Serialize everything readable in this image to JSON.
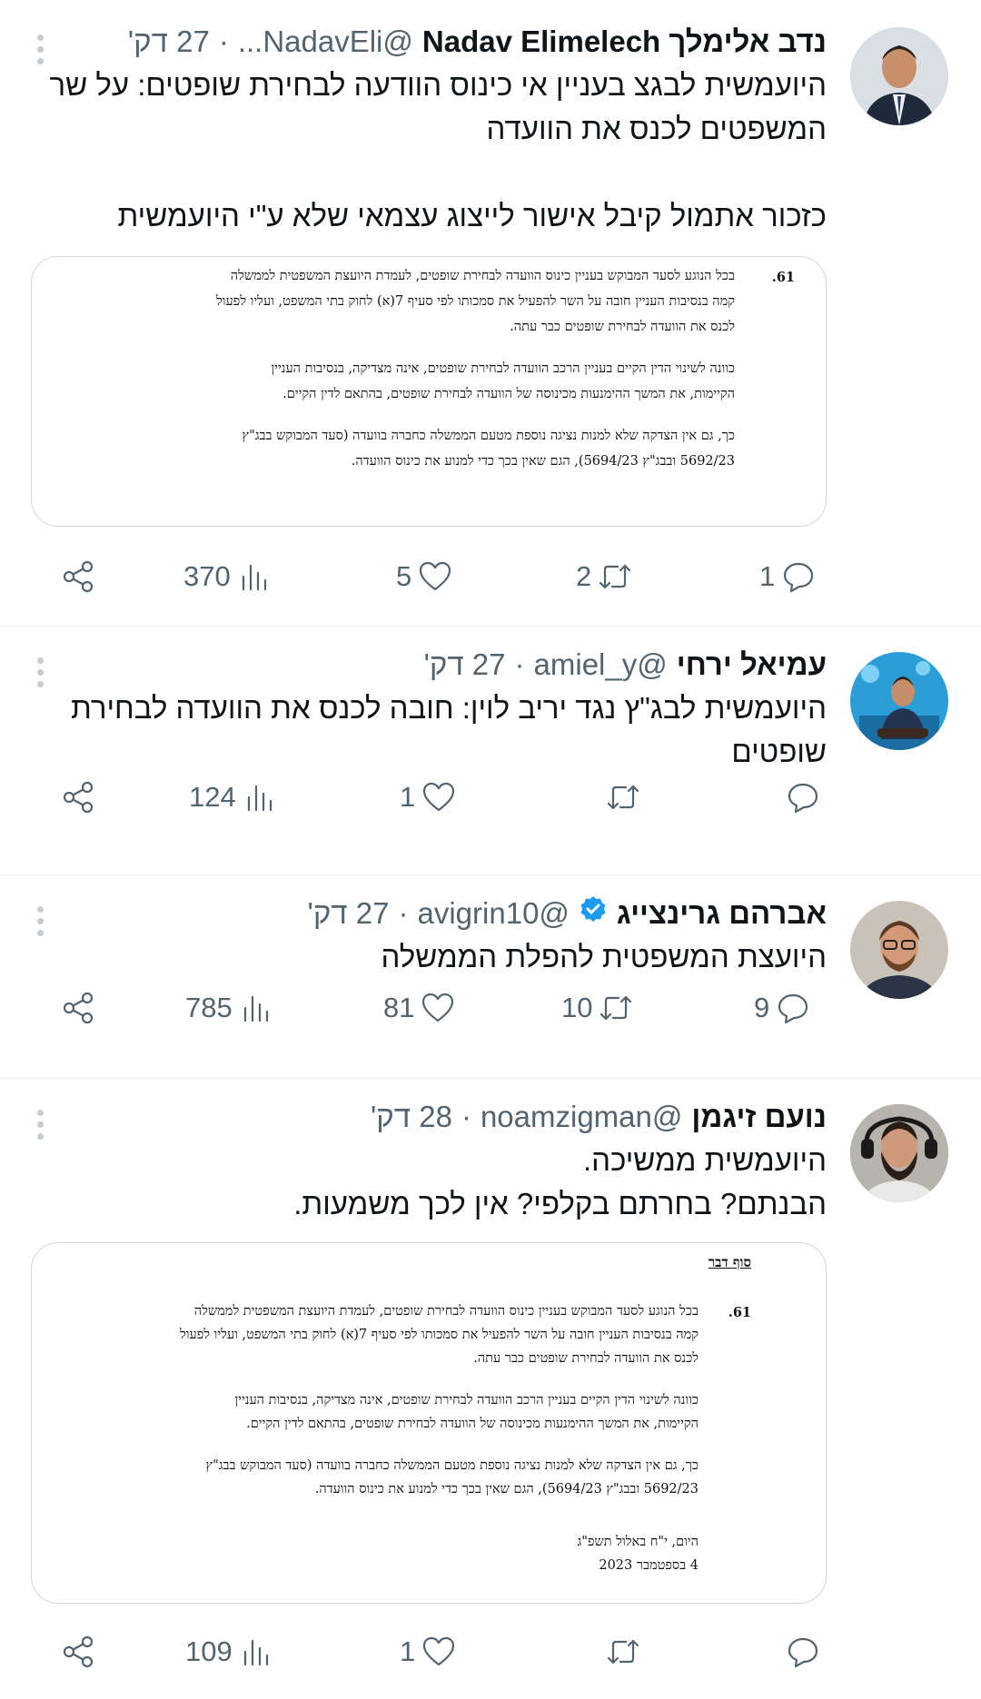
{
  "colors": {
    "accent": "#1d9bf0",
    "secondary_text": "#536471",
    "border": "#cfd9de"
  },
  "tweets": [
    {
      "name": "נדב אלימלך Nadav Elimelech",
      "handle": "@NadavEli...",
      "dot": "·",
      "time": "27 דק'",
      "text": "היועמשית לבגצ בעניין אי כינוס הוודעה לבחירת שופטים: על שר המשפטים לכנס את הוועדה\n\nכזכור אתמול קיבל אישור לייצוג עצמאי שלא ע\"י היועמשית",
      "doc": {
        "num": "61.",
        "p1": [
          "בכל הנוגע לסעד המבוקש בעניין כינוס הוועדה לבחירת שופטים, לעמדת היועצת המשפטית לממשלה",
          "קמה בנסיבות העניין חובה על השר להפעיל את סמכותו לפי סעיף 7(א) לחוק בתי המשפט, ועליו לפעול",
          "לכנס את הוועדה לבחירת שופטים כבר עתה."
        ],
        "p2": [
          "כוונה לשינוי הדין הקיים בעניין הרכב הוועדה לבחירת שופטים, אינה מצדיקה, בנסיבות העניין",
          "הקיימות, את המשך ההימנעות מכינוסה של הוועדה לבחירת שופטים, בהתאם לדין הקיים."
        ],
        "p3": [
          "כך, גם אין הצדקה שלא למנות נציגה נוספת מטעם הממשלה כחברה בוועדה (סעד המבוקש בבג\"ץ",
          "5692/23 ובבג\"ץ 5694/23), הגם שאין בכך כדי למנוע את כינוס הוועדה."
        ]
      },
      "reply_count": "1",
      "retweet_count": "2",
      "like_count": "5",
      "view_count": "370"
    },
    {
      "name": "עמיאל ירחי",
      "handle": "@amiel_y",
      "dot": "·",
      "time": "27 דק'",
      "text": "היועמשית לבג\"ץ נגד יריב לוין: חובה לכנס את הוועדה לבחירת שופטים",
      "reply_count": "",
      "retweet_count": "",
      "like_count": "1",
      "view_count": "124"
    },
    {
      "name": "אברהם גרינצייג",
      "handle": "@avigrin10",
      "dot": "·",
      "time": "27 דק'",
      "text": "היועצת המשפטית להפלת הממשלה",
      "reply_count": "9",
      "retweet_count": "10",
      "like_count": "81",
      "view_count": "785"
    },
    {
      "name": "נועם זיגמן",
      "handle": "@noamzigman",
      "dot": "·",
      "time": "28 דק'",
      "text": "היועמשית ממשיכה.\nהבנתם? בחרתם בקלפי? אין לכך משמעות.",
      "doc": {
        "title": "סוף דבר",
        "num": "61.",
        "p1": [
          "בכל הנוגע לסעד המבוקש בעניין כינוס הוועדה לבחירת שופטים, לעמדת היועצת המשפטית לממשלה",
          "קמה בנסיבות העניין חובה על השר להפעיל את סמכותו לפי סעיף 7(א) לחוק בתי המשפט, ועליו לפעול",
          "לכנס את הוועדה לבחירת שופטים כבר עתה."
        ],
        "p2": [
          "כוונה לשינוי הדין הקיים בעניין הרכב הוועדה לבחירת שופטים, אינה מצדיקה, בנסיבות העניין",
          "הקיימות, את המשך ההימנעות מכינוסה של הוועדה לבחירת שופטים, בהתאם לדין הקיים."
        ],
        "p3": [
          "כך, גם אין הצדקה שלא למנות נציגה נוספת מטעם הממשלה כחברה בוועדה (סעד המבוקש בבג\"ץ",
          "5692/23 ובבג\"ץ 5694/23), הגם שאין בכך כדי למנוע את כינוס הוועדה."
        ],
        "date1": "היום, י\"ח באלול תשפ\"ג",
        "date2": "4 בספטמבר 2023"
      },
      "reply_count": "",
      "retweet_count": "",
      "like_count": "1",
      "view_count": "109"
    }
  ]
}
